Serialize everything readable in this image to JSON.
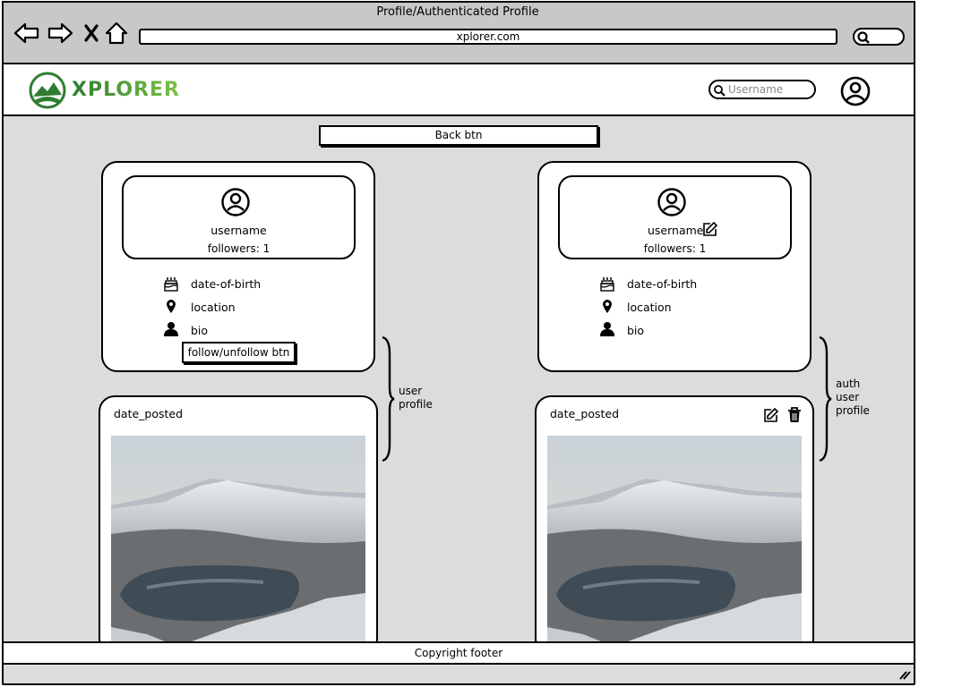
{
  "window": {
    "title": "Profile/Authenticated Profile",
    "url": "xplorer.com"
  },
  "header": {
    "brand": "XPLORER",
    "search_placeholder": "Username"
  },
  "back_button": "Back btn",
  "user_profile": {
    "username": "username",
    "followers": "followers: 1",
    "details": {
      "dob": "date-of-birth",
      "location": "location",
      "bio": "bio"
    },
    "follow_button": "follow/unfollow btn",
    "post": {
      "date": "date_posted"
    }
  },
  "auth_profile": {
    "username": "username",
    "followers": "followers: 1",
    "details": {
      "dob": "date-of-birth",
      "location": "location",
      "bio": "bio"
    },
    "post": {
      "date": "date_posted"
    }
  },
  "annotations": {
    "user_profile": [
      "user",
      "profile"
    ],
    "auth_profile": [
      "auth",
      "user",
      "profile"
    ]
  },
  "footer": "Copyright footer",
  "colors": {
    "brand_green": "#2e8b3a",
    "brand_green_light": "#7cc242"
  }
}
